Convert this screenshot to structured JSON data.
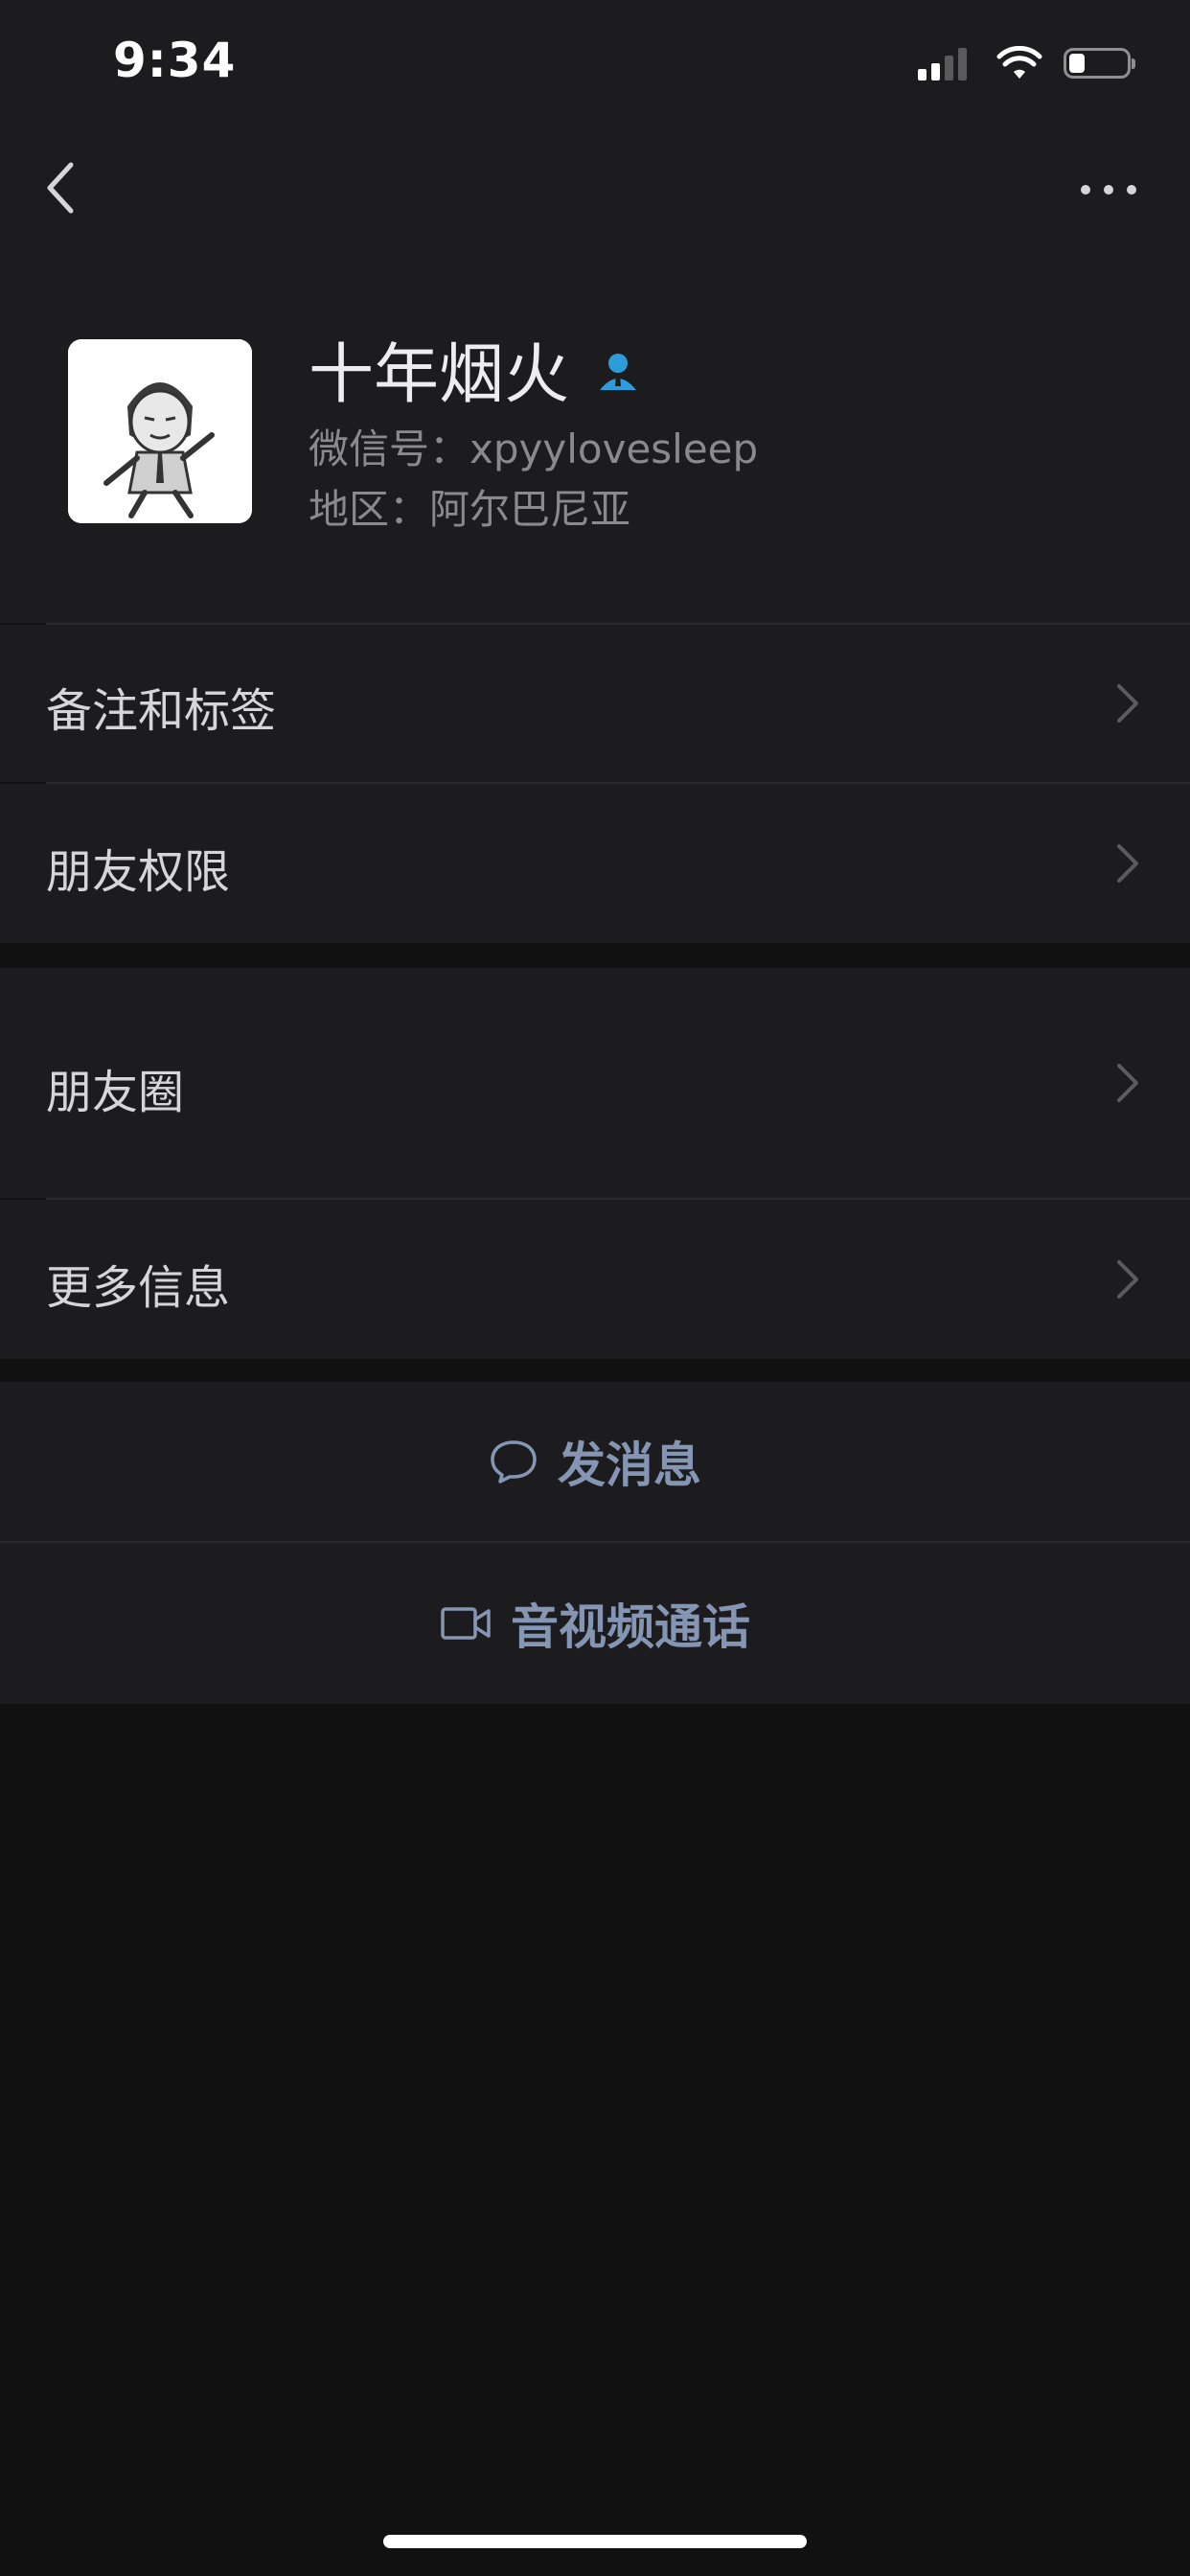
{
  "status_bar": {
    "time": "9:34",
    "icons": [
      "cellular-signal-icon",
      "wifi-icon",
      "battery-icon"
    ]
  },
  "nav": {
    "back_icon": "chevron-left-icon",
    "more_icon": "ellipsis-icon"
  },
  "profile": {
    "name": "十年烟火",
    "name_badge_icon": "person-icon",
    "wechat_id": "微信号：xpyylovesleep",
    "region": "地区：阿尔巴尼亚"
  },
  "menu_group_1": [
    {
      "label": "备注和标签"
    },
    {
      "label": "朋友权限"
    }
  ],
  "menu_group_2": [
    {
      "label": "朋友圈"
    },
    {
      "label": "更多信息"
    }
  ],
  "actions": {
    "message_label": "发消息",
    "message_icon": "chat-bubble-icon",
    "call_label": "音视频通话",
    "call_icon": "video-camera-icon"
  },
  "colors": {
    "background": "#111111",
    "cell_background": "#1c1c1e",
    "action_text": "#8596b5",
    "badge_blue": "#2d9cdb"
  }
}
